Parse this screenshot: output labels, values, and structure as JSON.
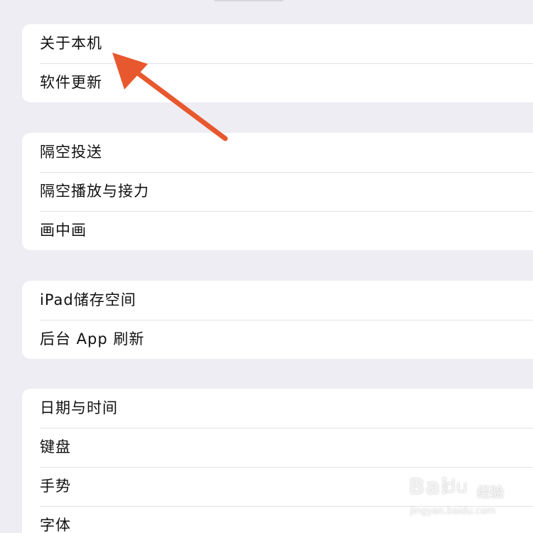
{
  "groups": [
    {
      "items": [
        {
          "label": "关于本机"
        },
        {
          "label": "软件更新"
        }
      ]
    },
    {
      "items": [
        {
          "label": "隔空投送"
        },
        {
          "label": "隔空播放与接力"
        },
        {
          "label": "画中画"
        }
      ]
    },
    {
      "items": [
        {
          "label": "iPad储存空间"
        },
        {
          "label": "后台 App 刷新"
        }
      ]
    },
    {
      "items": [
        {
          "label": "日期与时间"
        },
        {
          "label": "键盘"
        },
        {
          "label": "手势"
        },
        {
          "label": "字体"
        }
      ]
    }
  ],
  "annotation": {
    "arrow_color": "#e8582e"
  },
  "watermark": {
    "brand": "Bai",
    "paw": "du",
    "cn": "经验",
    "url": "jingyan.baidu.com"
  }
}
